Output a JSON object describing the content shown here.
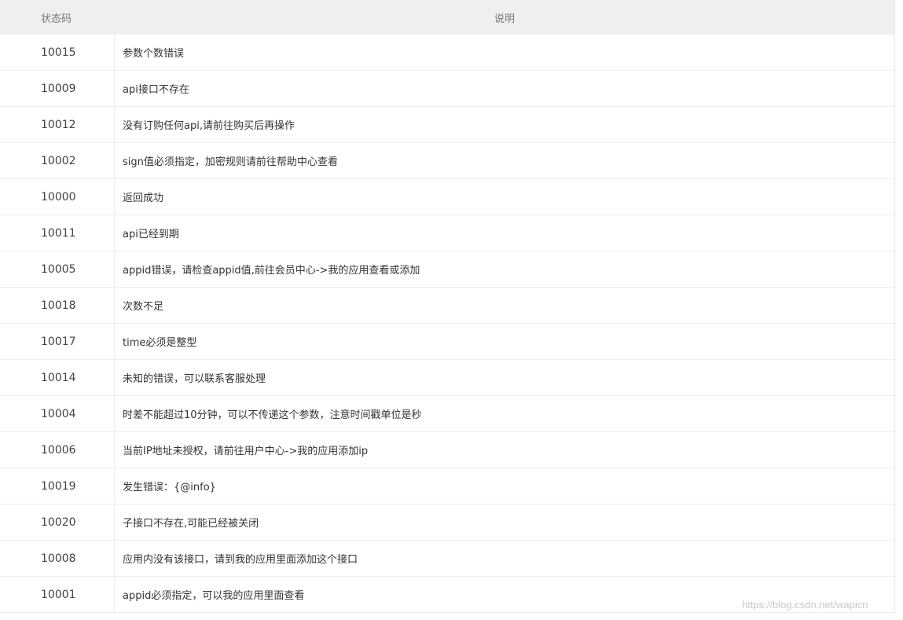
{
  "table": {
    "headers": {
      "code": "状态码",
      "description": "说明"
    },
    "rows": [
      {
        "code": "10015",
        "description": "参数个数错误"
      },
      {
        "code": "10009",
        "description": "api接口不存在"
      },
      {
        "code": "10012",
        "description": "没有订购任何api,请前往购买后再操作"
      },
      {
        "code": "10002",
        "description": "sign值必须指定，加密规则请前往帮助中心查看"
      },
      {
        "code": "10000",
        "description": "返回成功"
      },
      {
        "code": "10011",
        "description": "api已经到期"
      },
      {
        "code": "10005",
        "description": "appid错误，请检查appid值,前往会员中心->我的应用查看或添加"
      },
      {
        "code": "10018",
        "description": "次数不足"
      },
      {
        "code": "10017",
        "description": "time必须是整型"
      },
      {
        "code": "10014",
        "description": "未知的错误，可以联系客服处理"
      },
      {
        "code": "10004",
        "description": "时差不能超过10分钟，可以不传递这个参数，注意时间戳单位是秒"
      },
      {
        "code": "10006",
        "description": "当前IP地址未授权，请前往用户中心->我的应用添加ip"
      },
      {
        "code": "10019",
        "description": "发生错误：{@info}"
      },
      {
        "code": "10020",
        "description": "子接口不存在,可能已经被关闭"
      },
      {
        "code": "10008",
        "description": "应用内没有该接口，请到我的应用里面添加这个接口"
      },
      {
        "code": "10001",
        "description": "appid必须指定，可以我的应用里面查看"
      }
    ]
  },
  "watermark": "https://blog.csdn.net/wapicn"
}
